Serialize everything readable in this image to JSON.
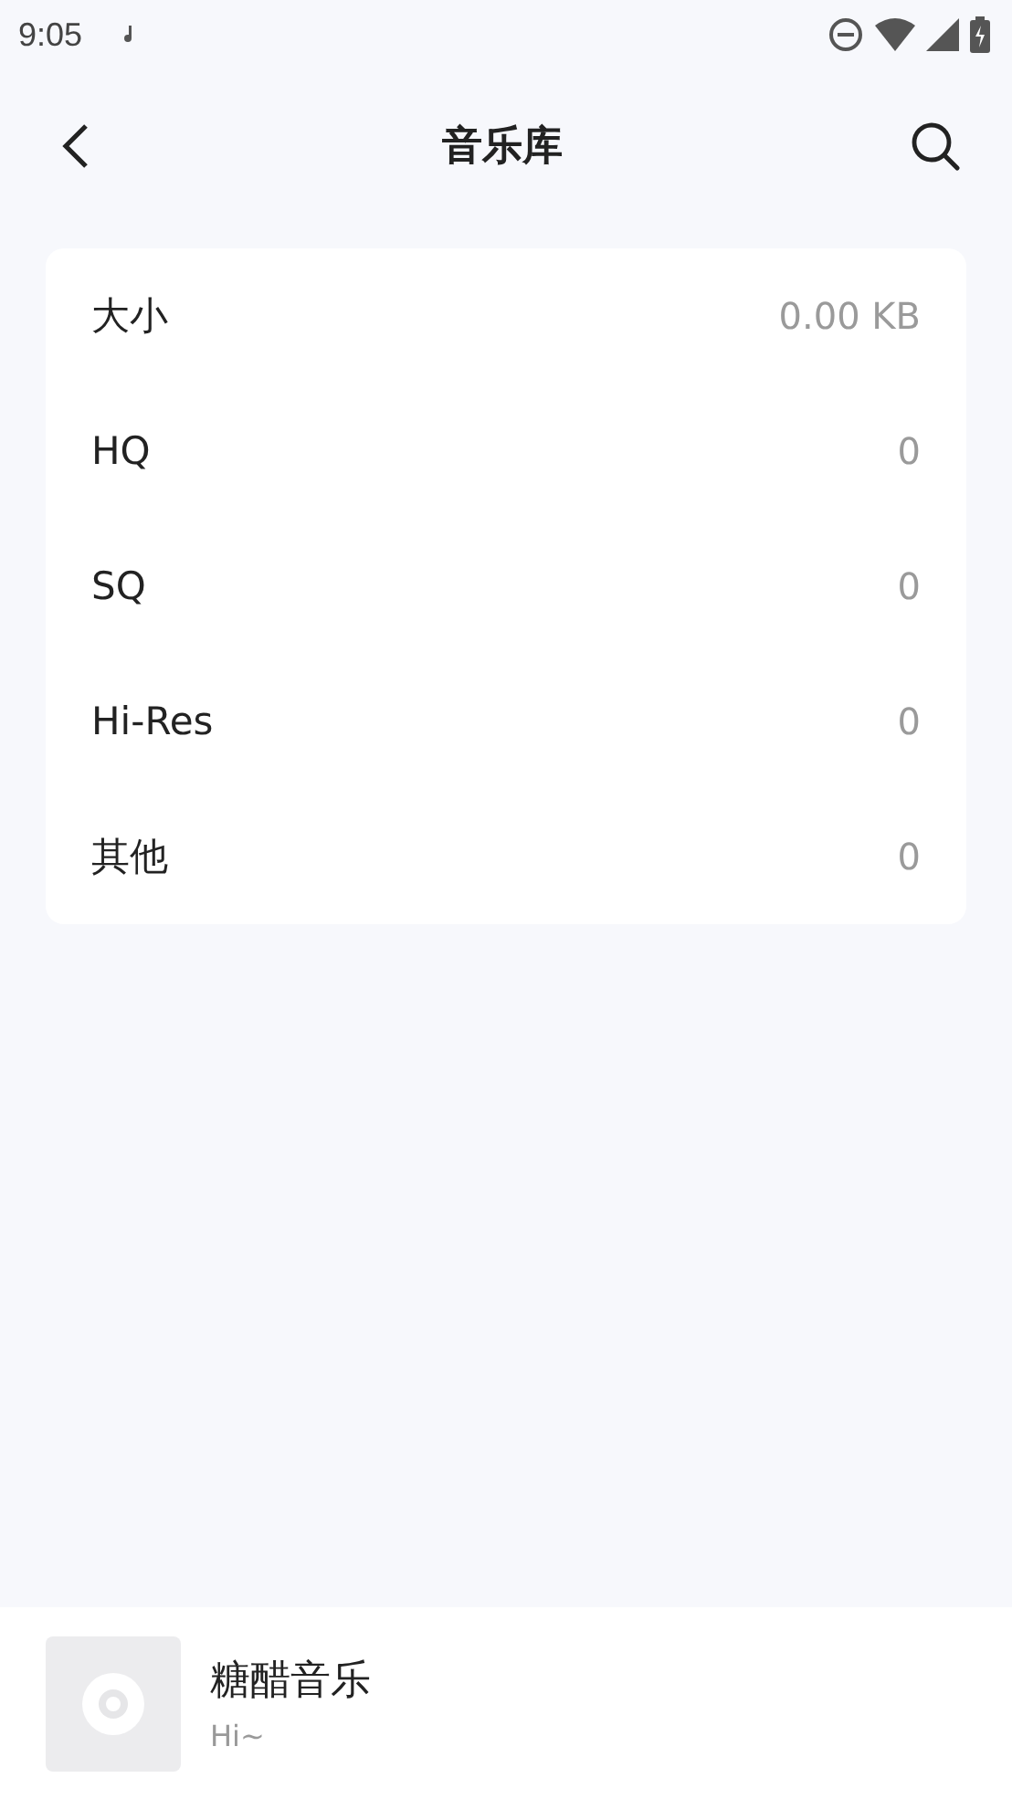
{
  "status_bar": {
    "time": "9:05"
  },
  "header": {
    "title": "音乐库"
  },
  "stats": [
    {
      "label": "大小",
      "value": "0.00 KB"
    },
    {
      "label": "HQ",
      "value": "0"
    },
    {
      "label": "SQ",
      "value": "0"
    },
    {
      "label": "Hi-Res",
      "value": "0"
    },
    {
      "label": "其他",
      "value": "0"
    }
  ],
  "player": {
    "title": "糖醋音乐",
    "subtitle": "Hi~"
  }
}
